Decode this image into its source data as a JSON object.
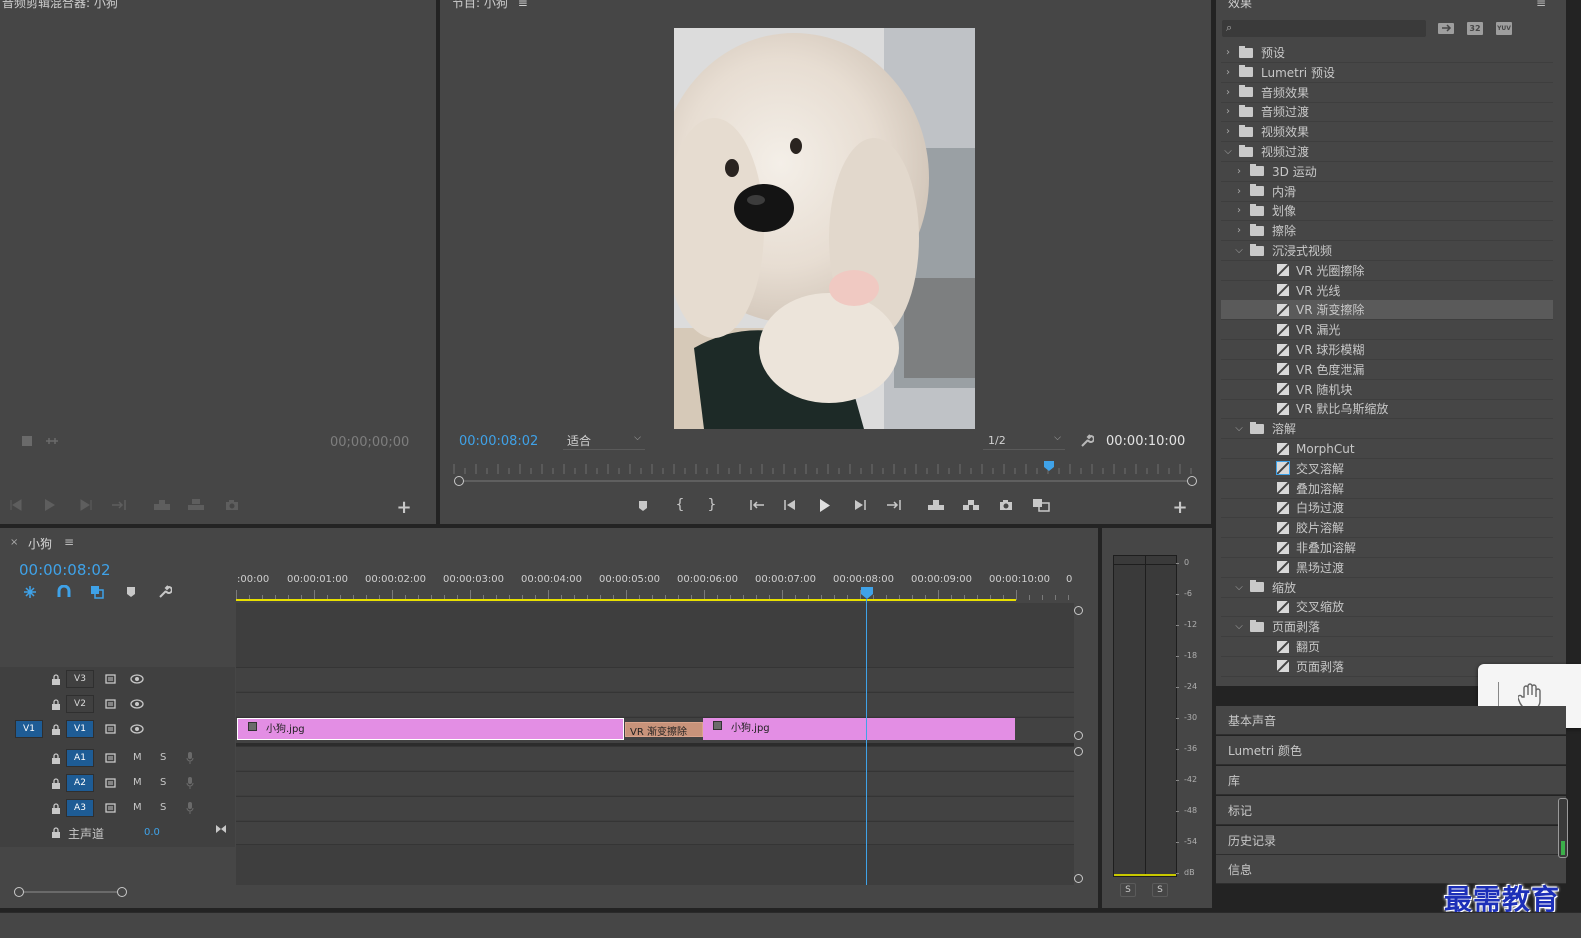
{
  "source_monitor": {
    "title": "音频剪辑混合器: 小狗",
    "timecode": "00;00;00;00"
  },
  "program_monitor": {
    "title": "节目: 小狗",
    "timecode_current": "00:00:08:02",
    "fit_label": "适合",
    "resolution": "1/2",
    "timecode_duration": "00:00:10:00",
    "playhead_fraction": 0.805
  },
  "effects": {
    "title": "效果",
    "search_placeholder": "",
    "badge_32": "32",
    "badge_yuv": "YUV",
    "tree": [
      {
        "level": 0,
        "type": "folder",
        "open": false,
        "label": "预设",
        "special": true
      },
      {
        "level": 0,
        "type": "folder",
        "open": false,
        "label": "Lumetri 预设",
        "special": true
      },
      {
        "level": 0,
        "type": "folder",
        "open": false,
        "label": "音频效果"
      },
      {
        "level": 0,
        "type": "folder",
        "open": false,
        "label": "音频过渡"
      },
      {
        "level": 0,
        "type": "folder",
        "open": false,
        "label": "视频效果"
      },
      {
        "level": 0,
        "type": "folder",
        "open": true,
        "label": "视频过渡"
      },
      {
        "level": 1,
        "type": "folder",
        "open": false,
        "label": "3D 运动"
      },
      {
        "level": 1,
        "type": "folder",
        "open": false,
        "label": "内滑"
      },
      {
        "level": 1,
        "type": "folder",
        "open": false,
        "label": "划像"
      },
      {
        "level": 1,
        "type": "folder",
        "open": false,
        "label": "擦除"
      },
      {
        "level": 1,
        "type": "folder",
        "open": true,
        "label": "沉浸式视频"
      },
      {
        "level": 2,
        "type": "fx",
        "label": "VR 光圈擦除"
      },
      {
        "level": 2,
        "type": "fx",
        "label": "VR 光线"
      },
      {
        "level": 2,
        "type": "fx",
        "label": "VR 渐变擦除",
        "selected": true
      },
      {
        "level": 2,
        "type": "fx",
        "label": "VR 漏光"
      },
      {
        "level": 2,
        "type": "fx",
        "label": "VR 球形模糊"
      },
      {
        "level": 2,
        "type": "fx",
        "label": "VR 色度泄漏"
      },
      {
        "level": 2,
        "type": "fx",
        "label": "VR 随机块"
      },
      {
        "level": 2,
        "type": "fx",
        "label": "VR 默比乌斯缩放"
      },
      {
        "level": 1,
        "type": "folder",
        "open": true,
        "label": "溶解"
      },
      {
        "level": 2,
        "type": "fx",
        "label": "MorphCut"
      },
      {
        "level": 2,
        "type": "fx",
        "label": "交叉溶解",
        "outline": true
      },
      {
        "level": 2,
        "type": "fx",
        "label": "叠加溶解"
      },
      {
        "level": 2,
        "type": "fx",
        "label": "白场过渡"
      },
      {
        "level": 2,
        "type": "fx",
        "label": "胶片溶解"
      },
      {
        "level": 2,
        "type": "fx",
        "label": "非叠加溶解"
      },
      {
        "level": 2,
        "type": "fx",
        "label": "黑场过渡"
      },
      {
        "level": 1,
        "type": "folder",
        "open": true,
        "label": "缩放"
      },
      {
        "level": 2,
        "type": "fx",
        "label": "交叉缩放"
      },
      {
        "level": 1,
        "type": "folder",
        "open": true,
        "label": "页面剥落"
      },
      {
        "level": 2,
        "type": "fx",
        "label": "翻页"
      },
      {
        "level": 2,
        "type": "fx",
        "label": "页面剥落"
      }
    ]
  },
  "lower_panels": [
    "基本声音",
    "Lumetri 颜色",
    "库",
    "标记",
    "历史记录",
    "信息"
  ],
  "timeline": {
    "tab_label": "小狗",
    "timecode": "00:00:08:02",
    "ruler_labels": [
      ":00:00",
      "00:00:01:00",
      "00:00:02:00",
      "00:00:03:00",
      "00:00:04:00",
      "00:00:05:00",
      "00:00:06:00",
      "00:00:07:00",
      "00:00:08:00",
      "00:00:09:00",
      "00:00:10:00",
      "0"
    ],
    "tracks": {
      "v3": "V3",
      "v2": "V2",
      "v1_src": "V1",
      "v1": "V1",
      "a1": "A1",
      "a2": "A2",
      "a3": "A3",
      "m": "M",
      "s": "S",
      "master_label": "主声道",
      "master_value": "0.0"
    },
    "clip1_label": "小狗.jpg",
    "transition_label": "VR 渐变擦除",
    "clip2_label": "小狗.jpg"
  },
  "audio_meter": {
    "scale": [
      "0",
      "-6",
      "-12",
      "-18",
      "-24",
      "-30",
      "-36",
      "-42",
      "-48",
      "-54",
      "dB"
    ],
    "solo_left": "S",
    "solo_right": "S"
  },
  "watermark": "最需教育",
  "colors": {
    "accent": "#3fa2e8",
    "clip": "#e38ee4",
    "transition": "#c8937a",
    "work_area": "#e8e000"
  }
}
